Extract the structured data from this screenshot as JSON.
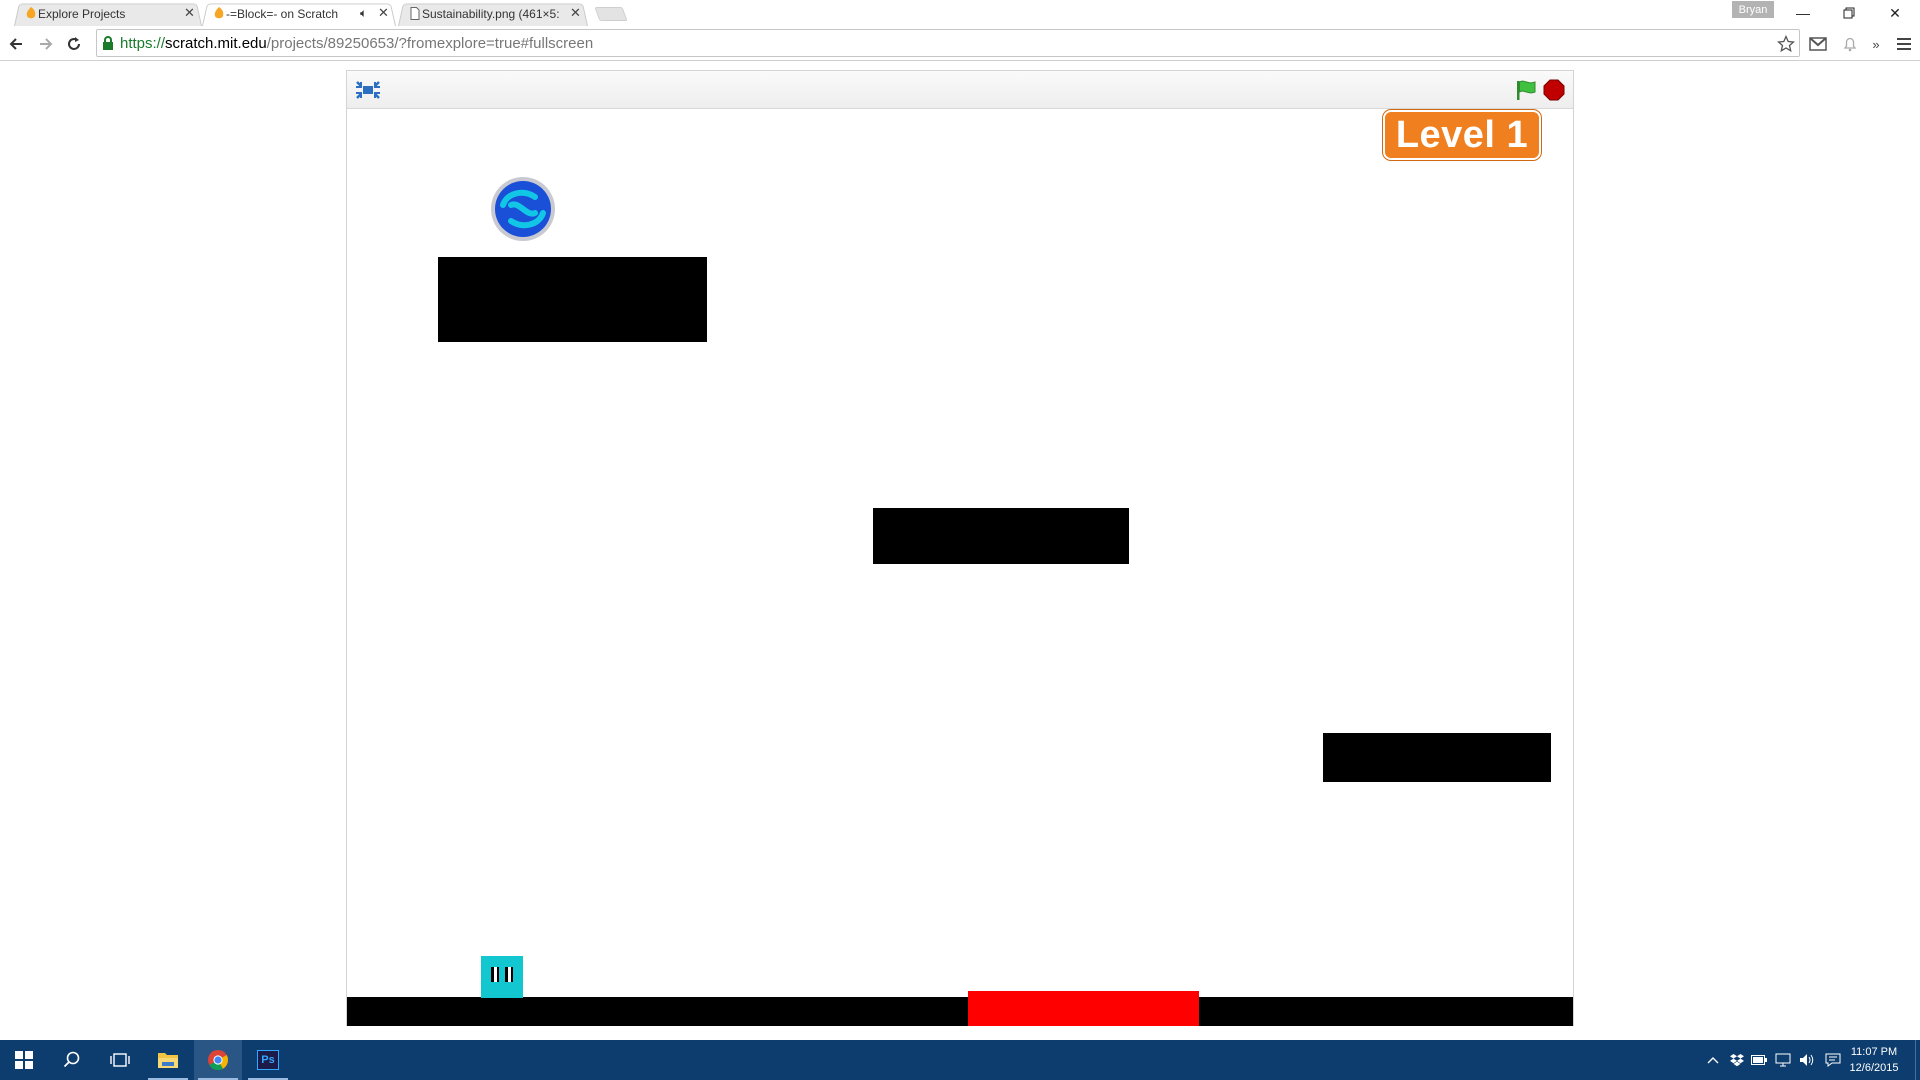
{
  "browser": {
    "tabs": [
      {
        "title": "Explore Projects",
        "icon": "scratch-favicon-icon",
        "active": false
      },
      {
        "title": "-=Block=- on Scratch",
        "icon": "scratch-favicon-icon",
        "active": true,
        "audio": true
      },
      {
        "title": "Sustainability.png (461×5:",
        "icon": "document-icon",
        "active": false
      }
    ],
    "profile_name": "Bryan",
    "url": {
      "secure": "https://",
      "host": "scratch.mit.edu",
      "path": "/projects/89250653/?fromexplore=true#fullscreen"
    }
  },
  "player": {
    "level_label": "Level 1",
    "controls": [
      "unfullscreen-icon",
      "green-flag-icon",
      "stop-icon"
    ]
  },
  "game": {
    "platform_color": "#000000",
    "hazard_color": "#ff0000",
    "player_color": "#12c7cf",
    "portal_color": "#1a4fd8"
  },
  "taskbar": {
    "apps": [
      "windows-start-icon",
      "search-icon",
      "task-view-icon",
      "file-explorer-icon",
      "chrome-icon",
      "photoshop-icon"
    ],
    "photoshop_label": "Ps",
    "clock_time": "11:07 PM",
    "clock_date": "12/6/2015"
  }
}
